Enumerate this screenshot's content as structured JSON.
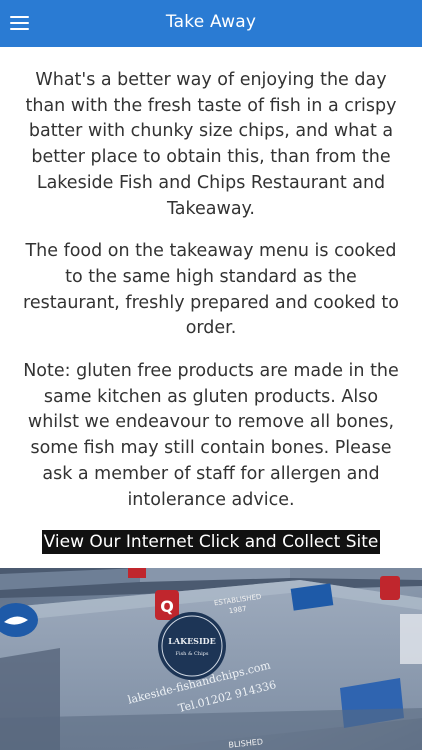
{
  "header": {
    "title": "Take Away",
    "menu_icon": "hamburger-menu-icon",
    "color": "#2a7bd3"
  },
  "content": {
    "paragraphs": [
      "What's a better way of enjoying the day than with the fresh taste of fish in a crispy batter with chunky size chips, and what a better place to obtain this, than from the Lakeside Fish and Chips Restaurant and Takeaway.",
      "The food on the takeaway menu is cooked to the same high standard as the restaurant, freshly prepared and cooked to order.",
      "Note: gluten free products are made in the same kitchen as gluten products. Also whilst we endeavour to remove all bones, some fish may still contain bones. Please ask a member of staff for allergen and intolerance advice."
    ],
    "link_label": "View Our Internet Click and Collect Site"
  },
  "photo": {
    "seal_text": "LAKESIDE",
    "seal_subtext": "Fish & Chips",
    "established_label": "ESTABLISHED",
    "established_year": "1987",
    "website": "lakeside-fishandchips.com",
    "phone": "Tel.01202 914336",
    "bottom_label": "BLISHED"
  }
}
